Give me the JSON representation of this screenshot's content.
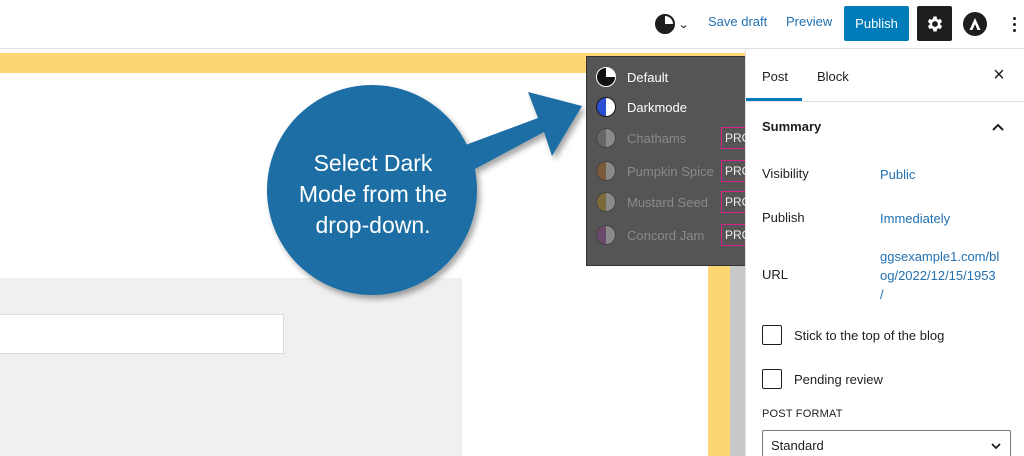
{
  "toolbar": {
    "save_draft": "Save draft",
    "preview": "Preview",
    "publish": "Publish"
  },
  "dropdown": {
    "items": [
      {
        "label": "Default",
        "enabled": true,
        "pro": false,
        "icon": "half-black-circle-icon"
      },
      {
        "label": "Darkmode",
        "enabled": true,
        "pro": false,
        "icon": "half-blue-circle-icon"
      },
      {
        "label": "Chathams",
        "enabled": false,
        "pro": true,
        "icon": "gray-circle-icon"
      },
      {
        "label": "Pumpkin Spice",
        "enabled": false,
        "pro": true,
        "icon": "orange-circle-icon"
      },
      {
        "label": "Mustard Seed",
        "enabled": false,
        "pro": true,
        "icon": "mustard-circle-icon"
      },
      {
        "label": "Concord Jam",
        "enabled": false,
        "pro": true,
        "icon": "purple-circle-icon"
      }
    ],
    "pro_badge": "PRO"
  },
  "callout": {
    "line1": "Select Dark",
    "line2": "Mode from the",
    "line3": "drop-down.",
    "color": "#1c6ea4"
  },
  "sidebar": {
    "tabs": [
      "Post",
      "Block"
    ],
    "summary_title": "Summary",
    "visibility_label": "Visibility",
    "visibility_value": "Public",
    "publish_label": "Publish",
    "publish_value": "Immediately",
    "url_label": "URL",
    "url_line1": "ggsexample1.com/bl",
    "url_line2": "og/2022/12/15/1953",
    "url_line3": "/",
    "stick_label": "Stick to the top of the blog",
    "pending_label": "Pending review",
    "post_format_label": "POST FORMAT",
    "post_format_value": "Standard"
  },
  "colors": {
    "accent": "#007cba",
    "link": "#2271b1",
    "highlight_yellow": "#fbd672",
    "dropdown_bg": "#555555",
    "pro_border": "#d6238a"
  }
}
